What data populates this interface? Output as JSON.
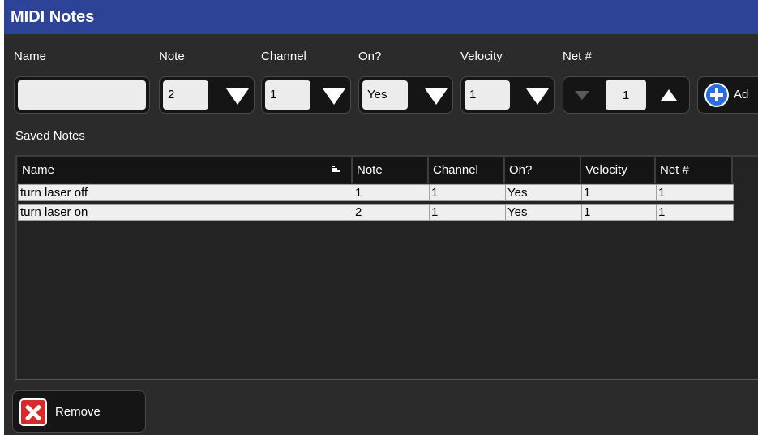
{
  "window": {
    "title": "MIDI Notes"
  },
  "form": {
    "name_label": "Name",
    "name_value": "",
    "note_label": "Note",
    "note_value": "2",
    "channel_label": "Channel",
    "channel_value": "1",
    "on_label": "On?",
    "on_value": "Yes",
    "velocity_label": "Velocity",
    "velocity_value": "1",
    "net_label": "Net #",
    "net_value": "1",
    "add_label": "Ad"
  },
  "saved": {
    "label": "Saved Notes",
    "columns": [
      "Name",
      "Note",
      "Channel",
      "On?",
      "Velocity",
      "Net #"
    ],
    "rows": [
      [
        "turn laser off",
        "1",
        "1",
        "Yes",
        "1",
        "1"
      ],
      [
        "turn laser on",
        "2",
        "1",
        "Yes",
        "1",
        "1"
      ]
    ]
  },
  "actions": {
    "remove_label": "Remove"
  },
  "icons": {
    "add": "plus-circle-icon",
    "remove": "x-square-icon",
    "dropdown": "triangle-down-icon",
    "sort": "sort-descending-icon"
  },
  "colors": {
    "titlebar": "#2d4397",
    "background": "#2b2b2b",
    "row": "#efefef",
    "add_icon": "#2a6de0",
    "remove_icon": "#d52b2b"
  }
}
